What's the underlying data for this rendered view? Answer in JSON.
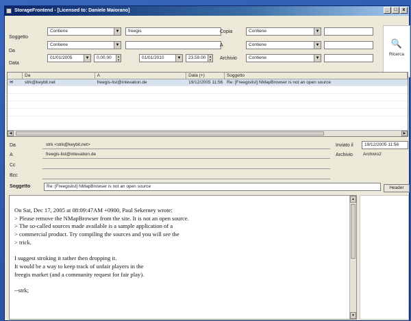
{
  "window": {
    "title": "StorageFrontend - [Licensed to: Daniele Maiorano]",
    "minimize": "_",
    "maximize": "□",
    "close": "x"
  },
  "search": {
    "labels": {
      "subject": "Soggetto",
      "from": "Da",
      "date": "Data",
      "cc": "Copia",
      "to": "A",
      "archive": "Archivio"
    },
    "subject_op": "Contiene",
    "subject_value": "freegis",
    "from_op": "Contiene",
    "from_value": "",
    "date_from": "01/01/2005",
    "time_from": "0.00.00",
    "date_to": "01/01/2010",
    "time_to": "23.59.00",
    "cc_op": "Contiene",
    "to_op": "Contiene",
    "archive_op": "Contiene",
    "button": "Ricerca"
  },
  "list": {
    "columns": [
      "Da",
      "A",
      "Data (+)",
      "Soggetto"
    ],
    "rows": [
      {
        "from": "strk@keybit.net",
        "to": "freegis-list@intevation.de",
        "date": "19/12/2005 11:56",
        "subject": "Re: [Freegislist] NMapBrowser is not an open source"
      }
    ]
  },
  "header": {
    "labels": {
      "from": "Da",
      "to": "A",
      "cc": "Cc",
      "bcc": "Bcc",
      "subject": "Soggetto",
      "sent": "Inviato il",
      "archive": "Archivio"
    },
    "from": "strk <strk@keybit.net>",
    "to": "freegis-list@intevation.de",
    "cc": "",
    "bcc": "",
    "subject": "Re: [Freegislist] NMapBrowser is not an open source",
    "sent": "19/12/2005 11:56",
    "archive": "Archivio2",
    "header_button": "Header"
  },
  "message_body": "On Sat, Dec 17, 2005 at 08:09:47AM +0900, Paul Sekerney wrote:\n> Please remove the NMapBrowser from the site. It is not an open source.\n> The so-called sources made available is a sample application of a\n> commercial product. Try compiling the sources and you will see the\n> trick.\n\nI suggest stroking it rather then dropping it.\nIt would be a way to keep track of unfair players in the\nfreegis market (and a community request for fair play).\n\n--strk;"
}
